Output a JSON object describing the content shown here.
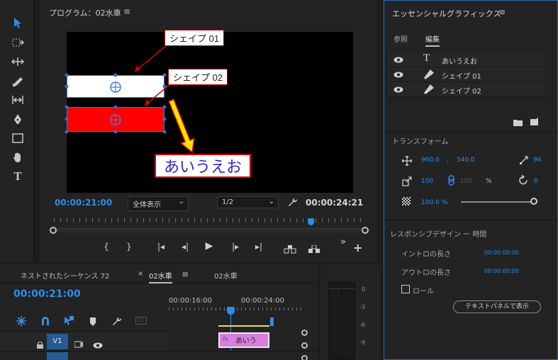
{
  "colors": {
    "accent": "#2d8ceb",
    "panel": "#232323",
    "background": "#1d1d1d",
    "annotation_border": "#cc0000",
    "shape_red": "#ff0000",
    "japanese_text": "#2b2bd0"
  },
  "program_monitor": {
    "title": "プログラム：02水車",
    "menu_icon": "≡",
    "current_timecode": "00:00:21:00",
    "zoom_select": "全体表示",
    "resolution_select": "1/2",
    "duration_timecode": "00:00:24:21",
    "playhead_fraction": 0.83,
    "transport": [
      "mark-in",
      "mark-out",
      "go-to-in",
      "step-back",
      "play",
      "step-forward",
      "go-to-out",
      "lift",
      "extract",
      "more",
      "add"
    ],
    "transport_glyphs": [
      "{",
      "}",
      "|◂",
      "◂|",
      "▶",
      "|▸",
      "▸|"
    ],
    "more_glyph": "»",
    "add_glyph": "+"
  },
  "video": {
    "annotation_1": "シェイプ 01",
    "annotation_2": "シェイプ 02",
    "japanese_text": "あいうえお"
  },
  "essential_graphics": {
    "title": "エッセンシャルグラフィックス",
    "menu_icon": "≡",
    "tabs": [
      {
        "label": "参照"
      },
      {
        "label": "編集"
      }
    ],
    "layers": [
      {
        "icon": "text-icon",
        "label": "あいうえお"
      },
      {
        "icon": "pen-icon",
        "label": "シェイプ 01"
      },
      {
        "icon": "pen-icon",
        "label": "シェイプ 02"
      }
    ],
    "transform_title": "トランスフォーム",
    "position_x": "960.0",
    "position_separator": ",",
    "position_y": "540.0",
    "anchor_value": "96",
    "scale": "100",
    "scale_height": "100",
    "scale_unit": "%",
    "rotation": "0",
    "opacity": "100.0 %",
    "responsive_title": "レスポンシブデザイン ー 時間",
    "intro_label": "イントロの長さ",
    "intro_value": "00:00:00:00",
    "outro_label": "アウトロの長さ",
    "outro_value": "00:00:00:00",
    "roll_label": "ロール",
    "text_panel_button": "テキストパネルで表示"
  },
  "timeline": {
    "tabs": [
      {
        "label": "ネストされたシーケンス 72",
        "close": ""
      },
      {
        "label": "02水車",
        "close": "×"
      },
      {
        "label": "02水車",
        "close": ""
      }
    ],
    "active_menu_icon": "≡",
    "current_timecode": "00:00:21:00",
    "ruler_labels": [
      "00:00:16:00",
      "00:00:24:00"
    ],
    "track_label": "V1",
    "clip_label": "あいう",
    "clip_icon": "fx"
  },
  "audio_meter": {
    "scale": [
      "0",
      "-3",
      "-6",
      "-9"
    ]
  }
}
